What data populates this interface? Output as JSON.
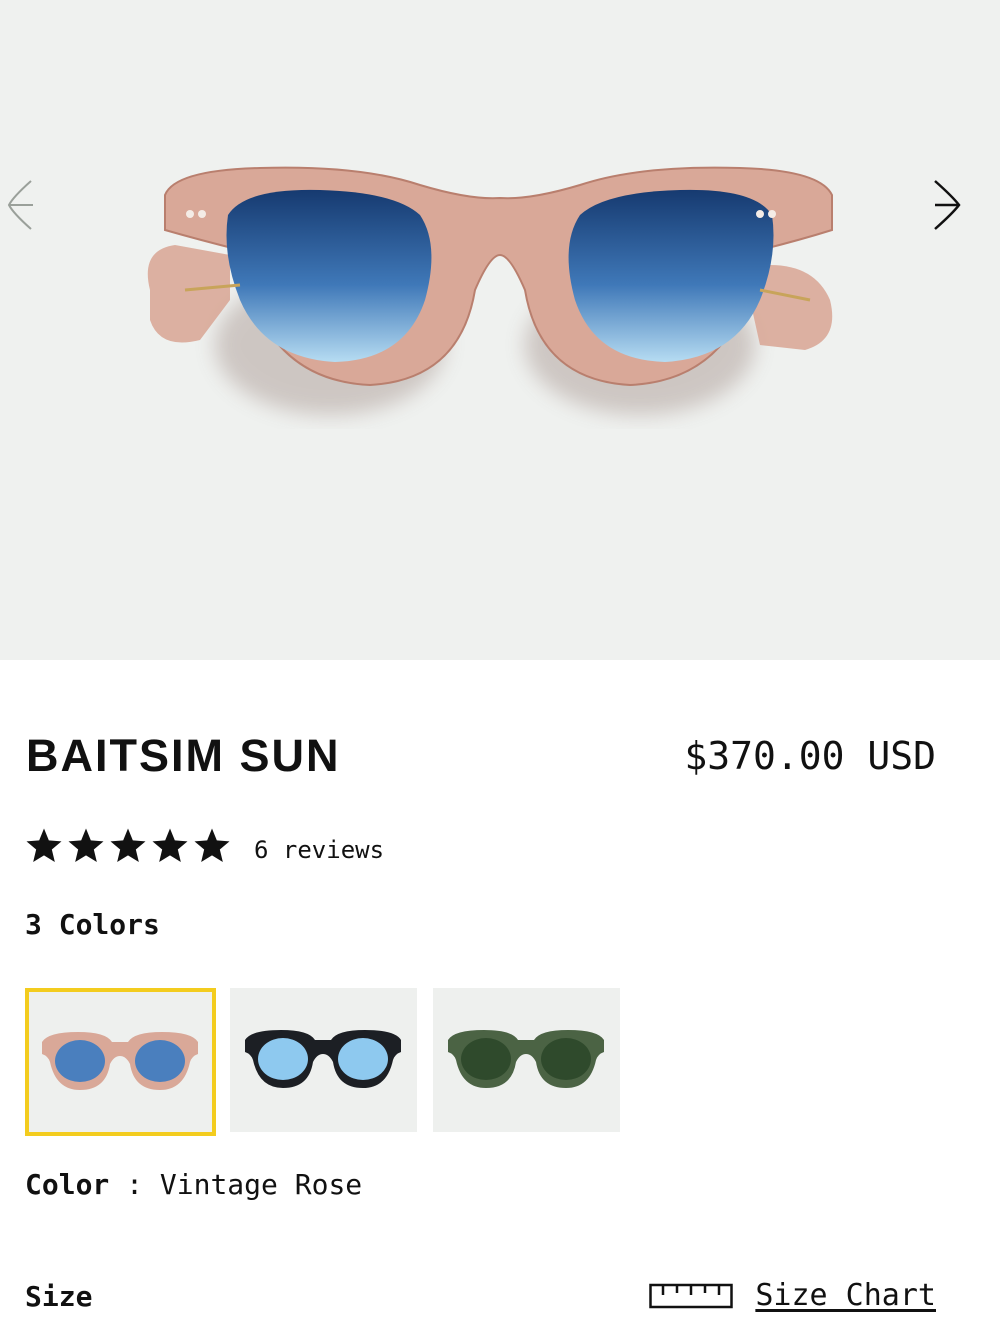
{
  "product": {
    "title": "BAITSIM SUN",
    "price": "$370.00 USD",
    "rating": 5,
    "reviews_label": "6 reviews",
    "colors_count_label": "3 Colors",
    "color_label": "Color",
    "color_separator": " : ",
    "selected_color": "Vintage Rose",
    "size_label": "Size",
    "size_chart_label": "Size Chart"
  },
  "swatches": [
    {
      "frame": "#d9a898",
      "lens": "#3f78b8",
      "selected": true
    },
    {
      "frame": "#1c1f24",
      "lens": "#8ec9ef",
      "selected": false
    },
    {
      "frame": "#3e5438",
      "lens": "#2f4a2c",
      "selected": false
    }
  ],
  "colors": {
    "hero_bg": "#eff1ef",
    "frame_rose": "#d9a898",
    "lens_blue": "#3f78b8",
    "selected_border": "#f3cc1e"
  },
  "icons": {
    "prev": "chevron-left-icon",
    "next": "chevron-right-icon",
    "star": "star-icon",
    "ruler": "ruler-icon"
  }
}
